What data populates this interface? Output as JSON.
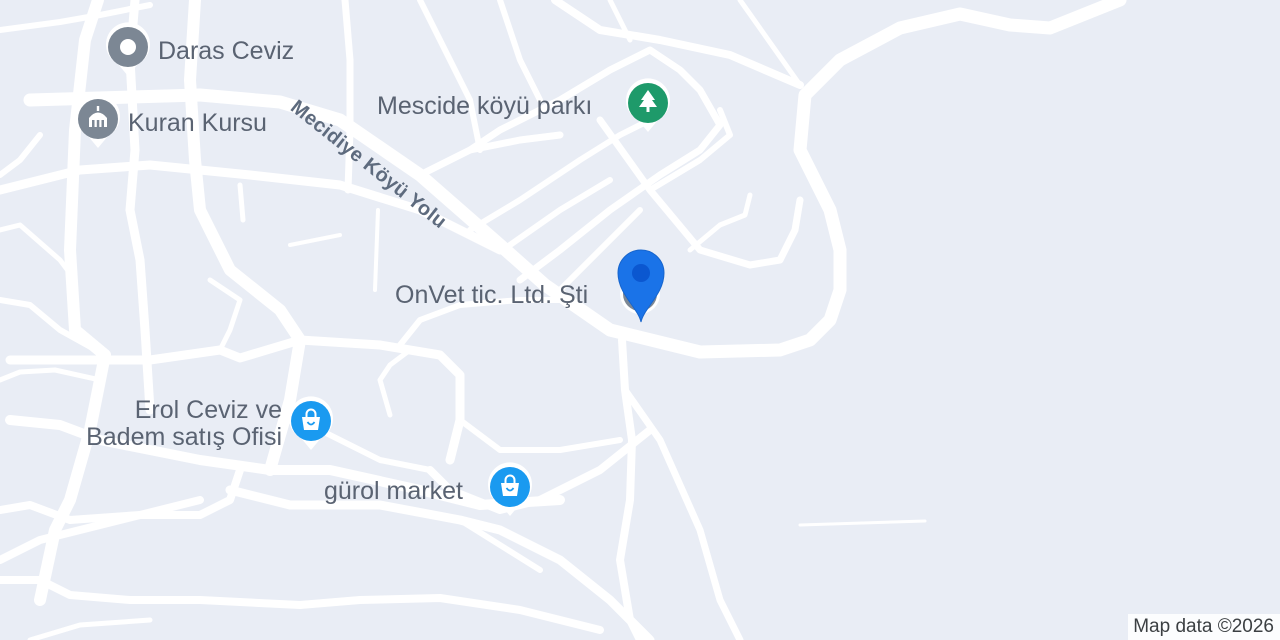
{
  "map": {
    "background": "#e9edf5",
    "road_color": "#ffffff",
    "street_label": "Mecidiye Köyü Yolu",
    "pois": [
      {
        "name": "Daras Ceviz",
        "category": "place-icon",
        "color": "#7c8794"
      },
      {
        "name": "Kuran Kursu",
        "category": "mosque-icon",
        "color": "#7c8794"
      },
      {
        "name": "Mescide köyü parkı",
        "category": "park-tree-icon",
        "color": "#1e9a6a"
      },
      {
        "name": "OnVet tic. Ltd. Şti",
        "category": "business-icon",
        "color": "#7c8794"
      },
      {
        "name_lines": [
          "Erol Ceviz ve",
          "Badem satış Ofisi"
        ],
        "category": "shopping-bag-icon",
        "color": "#1a9af0"
      },
      {
        "name": "gürol market",
        "category": "shopping-bag-icon",
        "color": "#1a9af0"
      }
    ],
    "selected_marker": {
      "color": "#1a73e8",
      "icon": "location-pin-icon"
    },
    "attribution": "Map data ©2026"
  }
}
